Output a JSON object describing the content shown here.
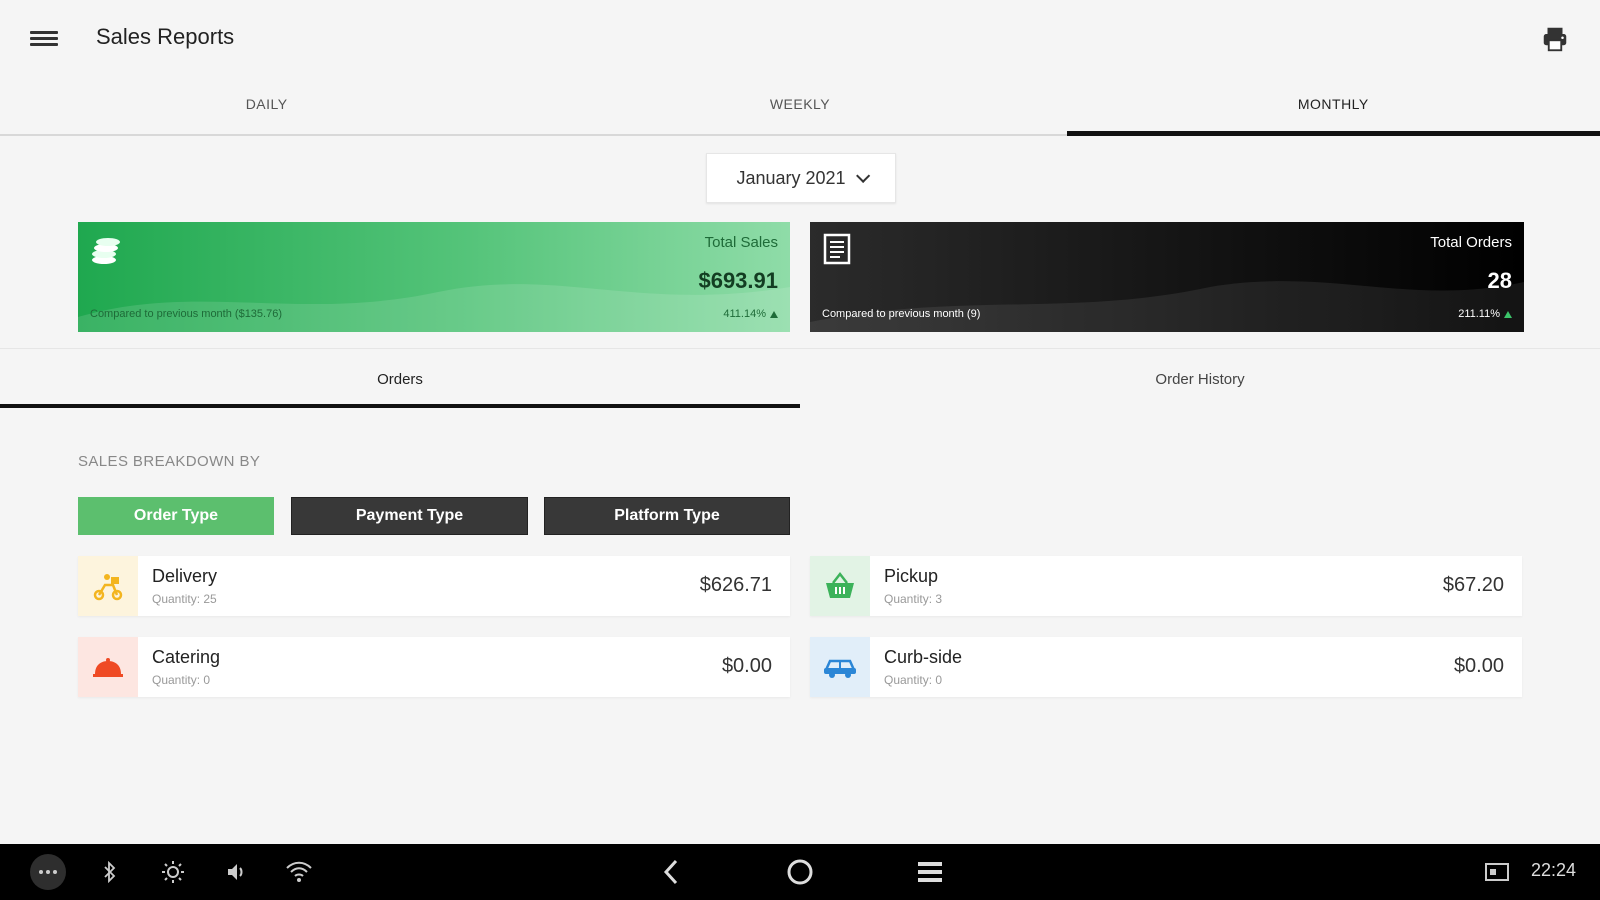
{
  "app": {
    "title": "Sales Reports"
  },
  "period_tabs": [
    {
      "label": "DAILY",
      "active": false
    },
    {
      "label": "WEEKLY",
      "active": false
    },
    {
      "label": "MONTHLY",
      "active": true
    }
  ],
  "month_selector": {
    "value": "January 2021"
  },
  "summary": {
    "sales": {
      "label": "Total Sales",
      "value": "$693.91",
      "compare": "Compared to previous month ($135.76)",
      "pct": "411.14%"
    },
    "orders": {
      "label": "Total Orders",
      "value": "28",
      "compare": "Compared to previous month (9)",
      "pct": "211.11%"
    }
  },
  "section_tabs": [
    {
      "label": "Orders",
      "active": true
    },
    {
      "label": "Order History",
      "active": false
    }
  ],
  "breakdown": {
    "label": "SALES BREAKDOWN BY",
    "filters": [
      "Order Type",
      "Payment Type",
      "Platform Type"
    ],
    "active_filter": "Order Type"
  },
  "order_types": [
    {
      "name": "Delivery",
      "quantity": "Quantity: 25",
      "amount": "$626.71",
      "icon": "delivery-icon",
      "color": "#f3b51f",
      "bg": "#fdf4dd"
    },
    {
      "name": "Pickup",
      "quantity": "Quantity: 3",
      "amount": "$67.20",
      "icon": "basket-icon",
      "color": "#3cb25a",
      "bg": "#e2f3e5"
    },
    {
      "name": "Catering",
      "quantity": "Quantity: 0",
      "amount": "$0.00",
      "icon": "cloche-icon",
      "color": "#ef4a24",
      "bg": "#fde6e1"
    },
    {
      "name": "Curb-side",
      "quantity": "Quantity: 0",
      "amount": "$0.00",
      "icon": "car-icon",
      "color": "#2b86d6",
      "bg": "#e1eef9"
    }
  ],
  "system_bar": {
    "time": "22:24"
  },
  "colors": {
    "accent_green": "#5cbf6e",
    "dark_button": "#383838",
    "tab_indicator": "#111111"
  }
}
